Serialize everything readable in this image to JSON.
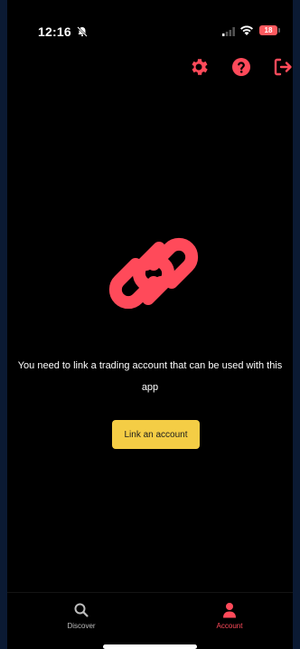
{
  "status_bar": {
    "time": "12:16",
    "battery": "18"
  },
  "top_actions": {
    "icons": [
      "gear-icon",
      "help-icon",
      "logout-icon"
    ]
  },
  "main": {
    "icon": "link-chain-icon",
    "message": "You need to link a trading account that can be used with this app",
    "button_label": "Link an account"
  },
  "tab_bar": {
    "tabs": [
      {
        "label": "Discover",
        "icon": "search-icon",
        "active": false
      },
      {
        "label": "Account",
        "icon": "person-icon",
        "active": true
      }
    ]
  },
  "colors": {
    "accent": "#ff4a5a",
    "button": "#f4cd45",
    "background": "#000000"
  }
}
